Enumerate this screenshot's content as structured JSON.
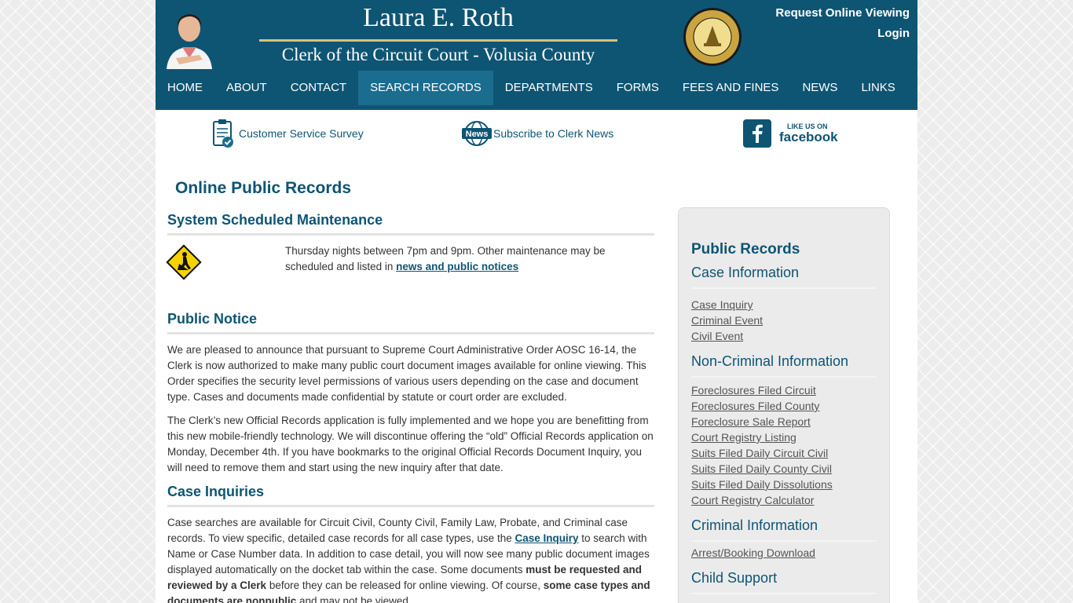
{
  "header": {
    "name": "Laura E. Roth",
    "title": "Clerk of the Circuit Court - Volusia County",
    "top_links": [
      "Request Online Viewing",
      "Login"
    ],
    "nav": [
      "HOME",
      "ABOUT",
      "CONTACT",
      "SEARCH RECORDS",
      "DEPARTMENTS",
      "FORMS",
      "FEES AND FINES",
      "NEWS",
      "LINKS"
    ],
    "active_nav": "SEARCH RECORDS",
    "brand_color": "#0e5573"
  },
  "utility": {
    "survey": "Customer Service Survey",
    "news_badge": "News",
    "news": "Subscribe to Clerk News",
    "fb_small": "LIKE US ON",
    "fb_big": "facebook"
  },
  "main": {
    "page_title": "Online Public Records",
    "maintenance": {
      "heading": "System Scheduled Maintenance",
      "text": "Thursday nights between 7pm and 9pm. Other maintenance may be scheduled and listed in ",
      "link": "news and public notices",
      "icon": "construction-worker-sign-icon"
    },
    "notice": {
      "heading": "Public Notice",
      "p1": "We are pleased to announce that pursuant to Supreme Court Administrative Order AOSC 16-14, the Clerk is now authorized to make many public court document images available for online viewing. This Order specifies the security level permissions of various users depending on the case and document type. Cases and documents made confidential by statute or court order are excluded.",
      "p2": "The Clerk’s new Official Records application is fully implemented and we hope you are benefitting from this new mobile-friendly technology. We will discontinue offering the “old” Official Records application on Monday, December 4th. If you have bookmarks to the original Official Records Document Inquiry, you will need to remove them and start using the new inquiry after that date."
    },
    "inquiries": {
      "heading": "Case Inquiries",
      "t1": "Case searches are available for Circuit Civil, County Civil, Family Law, Probate, and Criminal case records. To view specific, detailed case records for all case types, use the ",
      "link": "Case Inquiry",
      "t2": " to search with Name or Case Number data. In addition to case detail, you will now see many public document images displayed automatically on the docket tab within the case. Some documents ",
      "bold1": "must be requested and reviewed by a Clerk",
      "t3": " before they can be released for online viewing. Of course, ",
      "bold2": "some case types and documents are nonpublic",
      "t4": " and may not be viewed."
    }
  },
  "sidebar": {
    "title": "Public Records",
    "groups": [
      {
        "heading": "Case Information",
        "links": [
          "Case Inquiry",
          "Criminal Event",
          "Civil Event"
        ]
      },
      {
        "heading": "Non-Criminal Information",
        "links": [
          "Foreclosures Filed Circuit",
          "Foreclosures Filed County",
          "Foreclosure Sale Report",
          "Court Registry Listing",
          "Suits Filed Daily Circuit Civil",
          "Suits Filed Daily County Civil",
          "Suits Filed Daily Dissolutions",
          "Court Registry Calculator"
        ]
      },
      {
        "heading": "Criminal Information",
        "links": [
          "Arrest/Booking Download"
        ]
      },
      {
        "heading": "Child Support",
        "links": []
      }
    ]
  }
}
